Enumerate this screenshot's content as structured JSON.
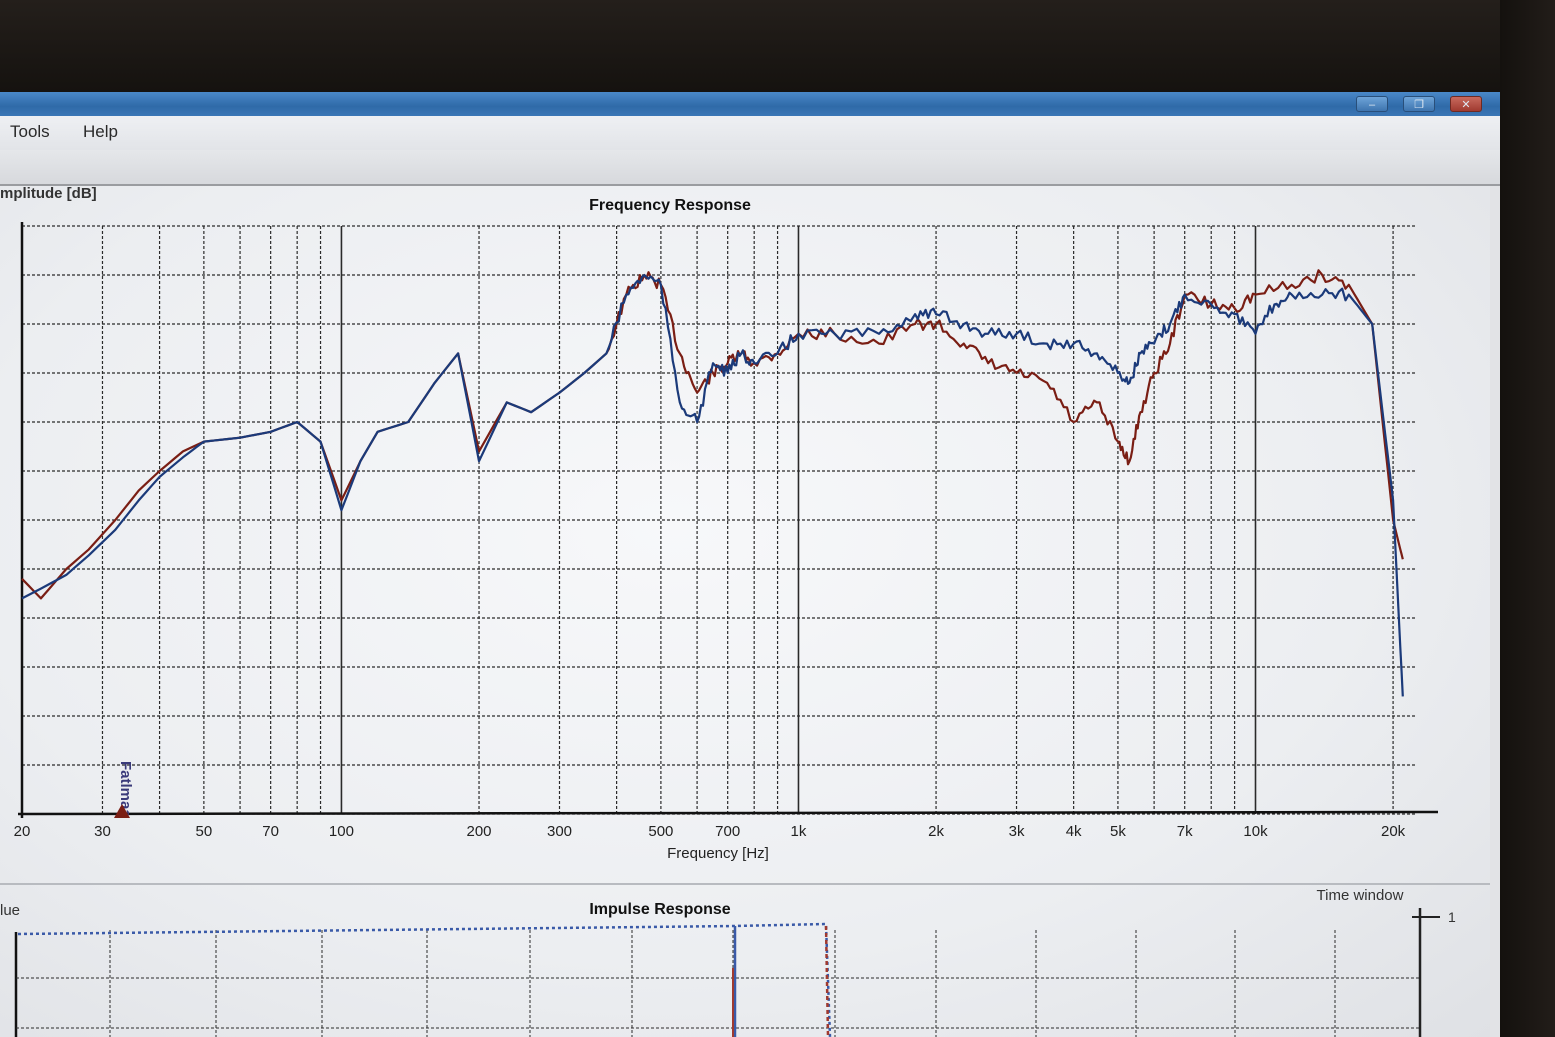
{
  "menu": {
    "tools": "Tools",
    "help": "Help"
  },
  "window_buttons": {
    "minimize": "–",
    "maximize": "❐",
    "close": "✕"
  },
  "frequency_chart": {
    "title": "Frequency Response",
    "ylabel": "mplitude [dB]",
    "xlabel": "Frequency [Hz]",
    "xticks": [
      "20",
      "30",
      "50",
      "70",
      "100",
      "200",
      "300",
      "500",
      "700",
      "1k",
      "2k",
      "3k",
      "4k",
      "5k",
      "7k",
      "10k",
      "20k"
    ],
    "watermark": "Fatlmaa"
  },
  "impulse_chart": {
    "title": "Impulse Response",
    "ylabel": "lue",
    "time_window_label": "Time window",
    "time_window_value": "1"
  },
  "colors": {
    "series_red": "#7a1e14",
    "series_blue": "#1b3a7a",
    "grid": "#2a2a2a"
  },
  "chart_data": [
    {
      "type": "line",
      "title": "Frequency Response",
      "xlabel": "Frequency [Hz]",
      "ylabel": "mplitude [dB]",
      "x_scale": "log",
      "xlim": [
        20,
        22000
      ],
      "grid": true,
      "series": [
        {
          "color": "#7a1e14",
          "x": [
            20,
            22,
            25,
            28,
            32,
            36,
            40,
            45,
            50,
            60,
            70,
            80,
            90,
            100,
            110,
            120,
            140,
            160,
            180,
            200,
            230,
            260,
            300,
            340,
            380,
            420,
            460,
            500,
            550,
            600,
            650,
            700,
            750,
            800,
            900,
            1000,
            1200,
            1500,
            1800,
            2000,
            2300,
            2600,
            3000,
            3500,
            4000,
            4500,
            5000,
            5300,
            5600,
            6000,
            6500,
            7000,
            8000,
            9000,
            10000,
            12000,
            14000,
            16000,
            18000,
            20000,
            21000
          ],
          "y": [
            -18,
            -19,
            -17.5,
            -16.5,
            -15,
            -13.5,
            -12.5,
            -11.5,
            -11,
            -10.8,
            -10.5,
            -10,
            -11,
            -14,
            -12,
            -10.5,
            -10,
            -8,
            -6.5,
            -11.5,
            -9,
            -9.5,
            -8.5,
            -7.5,
            -6.5,
            -3.5,
            -2.5,
            -3,
            -6.5,
            -8.5,
            -7.5,
            -7,
            -6.5,
            -7,
            -6.5,
            -5.5,
            -5.5,
            -6,
            -5,
            -5,
            -6,
            -7,
            -7.5,
            -8,
            -10,
            -9,
            -11,
            -12,
            -9.5,
            -7.5,
            -6,
            -3.5,
            -4,
            -4.2,
            -3.5,
            -3,
            -2.5,
            -3,
            -5,
            -15,
            -17
          ]
        },
        {
          "color": "#1b3a7a",
          "x": [
            20,
            22,
            25,
            28,
            32,
            36,
            40,
            45,
            50,
            60,
            70,
            80,
            90,
            100,
            110,
            120,
            140,
            160,
            180,
            200,
            230,
            260,
            300,
            340,
            380,
            420,
            460,
            500,
            550,
            600,
            650,
            700,
            750,
            800,
            900,
            1000,
            1200,
            1500,
            1800,
            2000,
            2300,
            2600,
            3000,
            3500,
            4000,
            4500,
            5000,
            5300,
            5600,
            6000,
            6500,
            7000,
            8000,
            9000,
            10000,
            11000,
            12000,
            14000,
            16000,
            18000,
            20000,
            21000
          ],
          "y": [
            -19,
            -18.5,
            -17.8,
            -16.8,
            -15.5,
            -14,
            -12.8,
            -11.8,
            -11,
            -10.8,
            -10.5,
            -10,
            -11,
            -14.5,
            -12,
            -10.5,
            -10,
            -8,
            -6.5,
            -12,
            -9,
            -9.5,
            -8.5,
            -7.5,
            -6.5,
            -3.5,
            -2.5,
            -3,
            -9,
            -10,
            -7,
            -7.5,
            -6.5,
            -7,
            -6.5,
            -5.5,
            -5.5,
            -5.5,
            -4.5,
            -4.5,
            -5,
            -5.5,
            -5.5,
            -6,
            -6,
            -6.5,
            -7.5,
            -8,
            -6.5,
            -6,
            -5,
            -3.5,
            -4,
            -4.5,
            -5.5,
            -4,
            -3.5,
            -3.5,
            -3.5,
            -5,
            -14,
            -24
          ]
        }
      ]
    },
    {
      "type": "line",
      "title": "Impulse Response",
      "ylabel": "lue",
      "grid": true,
      "series": []
    }
  ]
}
